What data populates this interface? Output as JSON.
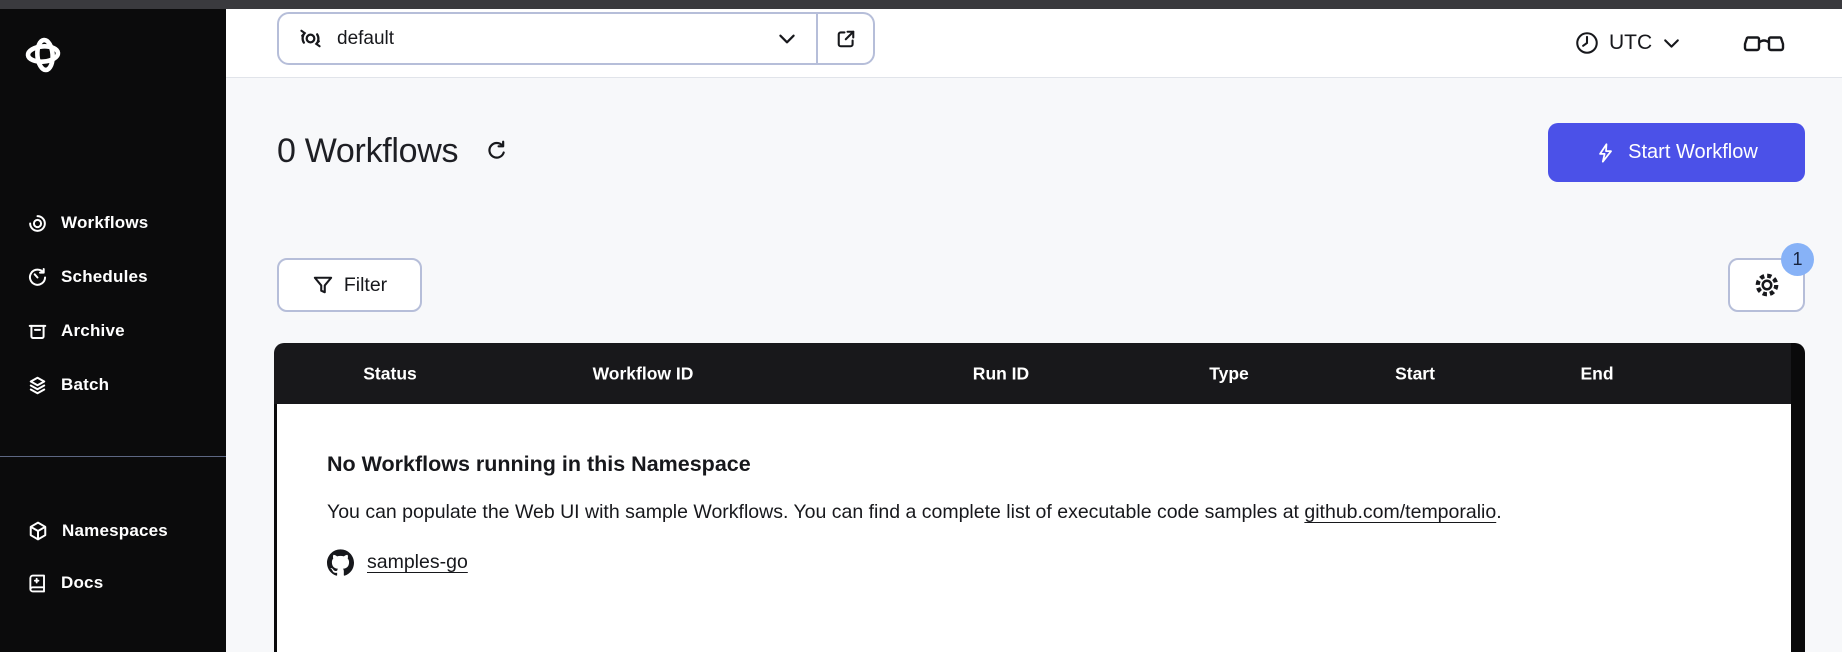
{
  "topbar": {
    "namespace": {
      "value": "default"
    },
    "timezone": {
      "label": "UTC"
    }
  },
  "sidebar": {
    "items": [
      {
        "label": "Workflows",
        "icon": "workflows-icon"
      },
      {
        "label": "Schedules",
        "icon": "schedules-icon"
      },
      {
        "label": "Archive",
        "icon": "archive-icon"
      },
      {
        "label": "Batch",
        "icon": "batch-icon"
      }
    ],
    "secondary_items": [
      {
        "label": "Namespaces",
        "icon": "namespaces-icon"
      },
      {
        "label": "Docs",
        "icon": "docs-icon"
      }
    ]
  },
  "main": {
    "title": "0 Workflows",
    "actions": {
      "start_workflow": "Start Workflow"
    },
    "filter": {
      "label": "Filter"
    },
    "settings": {
      "badge": "1"
    },
    "table": {
      "columns": [
        "Status",
        "Workflow ID",
        "Run ID",
        "Type",
        "Start",
        "End"
      ]
    },
    "empty": {
      "title": "No Workflows running in this Namespace",
      "body_text": "You can populate the Web UI with sample Workflows. You can find a complete list of executable code samples at ",
      "link": "github.com/temporalio",
      "period": ".",
      "repo_link": "samples-go"
    }
  },
  "colors": {
    "primary_button": "#4b51e8",
    "badge": "#87b2f7",
    "sidebar_bg": "#0b0b0c",
    "table_header_bg": "#18181b",
    "control_border": "#b6bed9",
    "page_bg": "#f7f8fa"
  }
}
